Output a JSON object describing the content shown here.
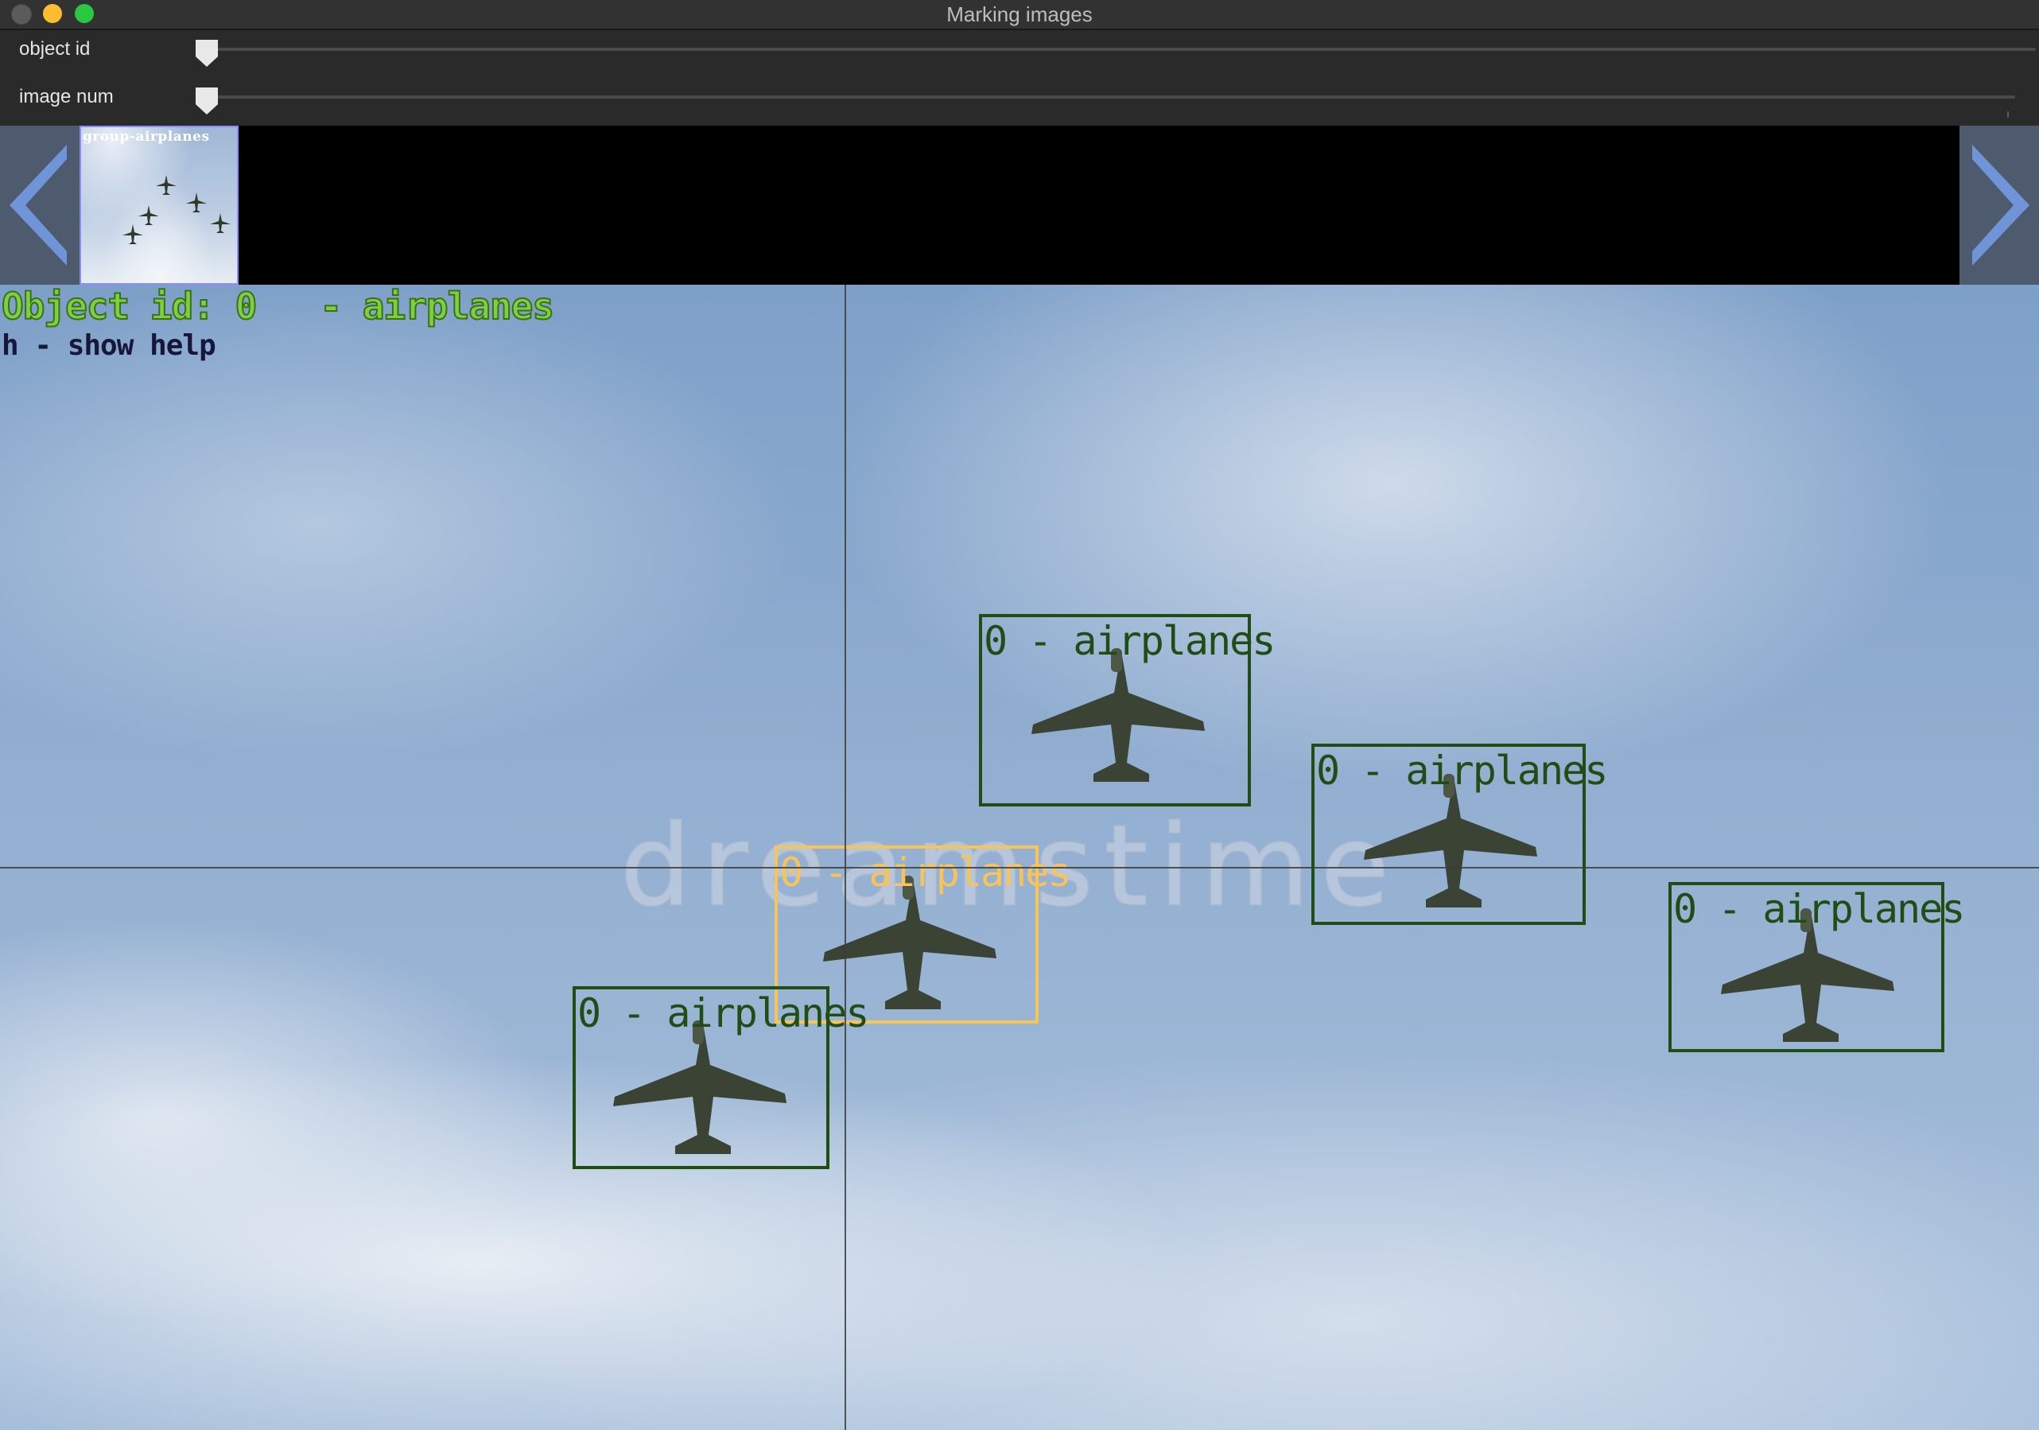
{
  "window": {
    "title": "Marking images"
  },
  "trackbars": [
    {
      "label": "object id",
      "value": 0
    },
    {
      "label": "image num",
      "value": 0
    }
  ],
  "filmstrip": {
    "thumbnail_caption": "group-airplanes",
    "selected_index": 0
  },
  "overlay": {
    "status": "Object id: 0   - airplanes",
    "help": "h - show help"
  },
  "watermark": "dreamstime",
  "boxes": [
    {
      "label": "0 - airplanes",
      "active": false
    },
    {
      "label": "0 - airplanes",
      "active": false
    },
    {
      "label": "0 - airplanes",
      "active": true
    },
    {
      "label": "0 - airplanes",
      "active": false
    },
    {
      "label": "0 - airplanes",
      "active": false
    }
  ],
  "colors": {
    "box_default": "#1f4d14",
    "box_active": "#f7c45a",
    "status_text": "#7cd141",
    "help_text": "#17173a",
    "thumbnail_border": "#8d8cf2",
    "nav_arrow": "#6f95d8"
  },
  "icons": {
    "prev": "triangle-left-icon",
    "next": "triangle-right-icon"
  }
}
